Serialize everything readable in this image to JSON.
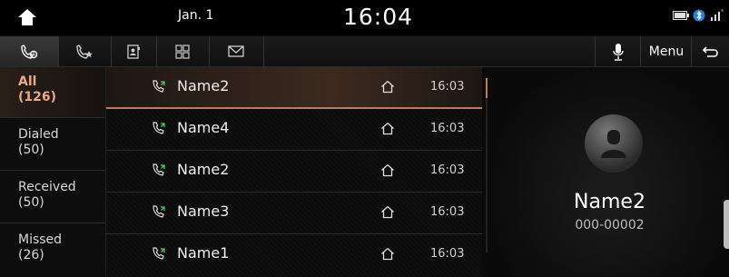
{
  "status": {
    "date": "Jan. 1",
    "time": "16:04"
  },
  "toolbar": {
    "menu_label": "Menu"
  },
  "categories": [
    {
      "label": "All",
      "count": "(126)"
    },
    {
      "label": "Dialed",
      "count": "(50)"
    },
    {
      "label": "Received",
      "count": "(50)"
    },
    {
      "label": "Missed",
      "count": "(26)"
    }
  ],
  "calls": [
    {
      "name": "Name2",
      "time": "16:03"
    },
    {
      "name": "Name4",
      "time": "16:03"
    },
    {
      "name": "Name2",
      "time": "16:03"
    },
    {
      "name": "Name3",
      "time": "16:03"
    },
    {
      "name": "Name1",
      "time": "16:03"
    }
  ],
  "detail": {
    "name": "Name2",
    "number": "000-00002"
  },
  "colors": {
    "accent": "#c07a55",
    "background": "#0a0a0a"
  }
}
